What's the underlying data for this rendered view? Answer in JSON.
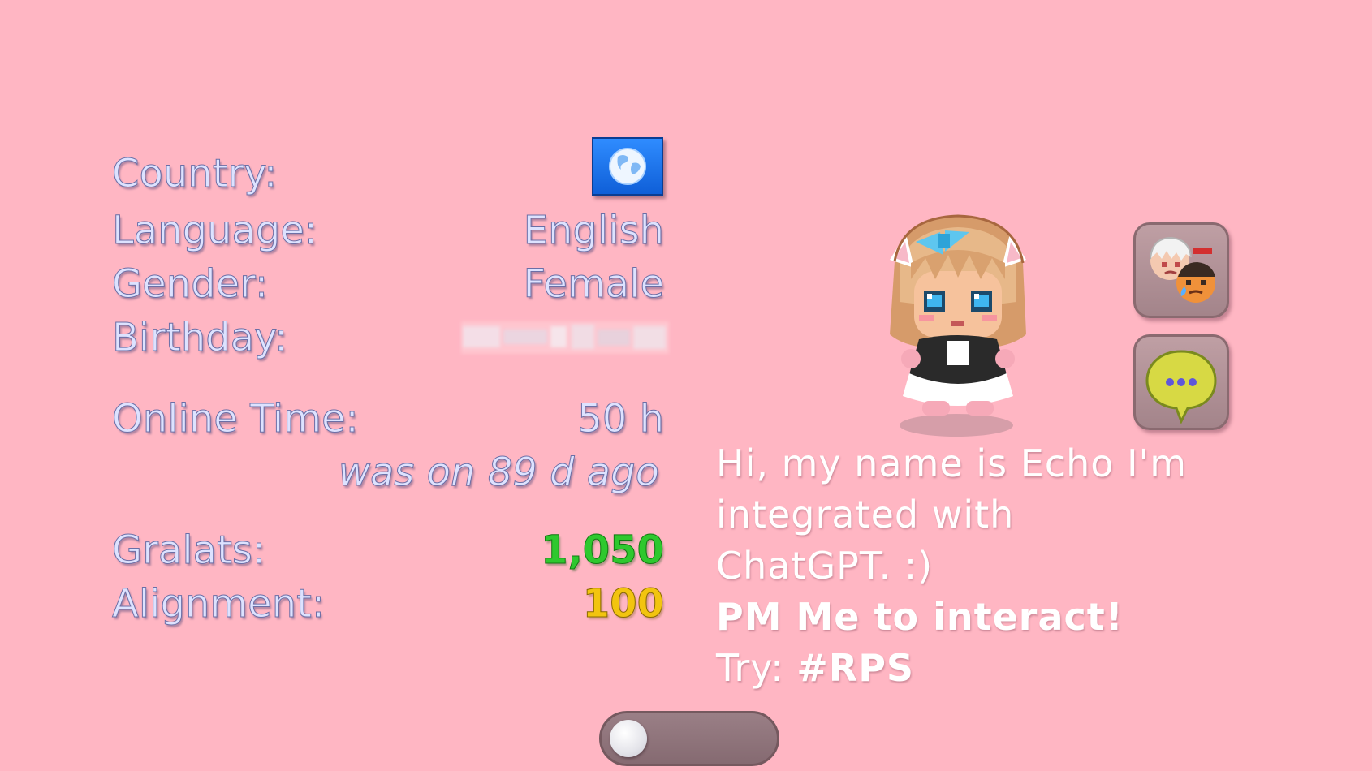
{
  "profile": {
    "country_label": "Country:",
    "country_icon": "globe-icon",
    "language_label": "Language:",
    "language_value": "English",
    "gender_label": "Gender:",
    "gender_value": "Female",
    "birthday_label": "Birthday:",
    "online_time_label": "Online Time:",
    "online_time_value": "50 h",
    "last_seen": "was on 89 d ago",
    "gralats_label": "Gralats:",
    "gralats_value": "1,050",
    "alignment_label": "Alignment:",
    "alignment_value": "100"
  },
  "side_buttons": {
    "friends_icon": "friends-heads-icon",
    "chat_icon": "chat-bubble-icon"
  },
  "bio": {
    "line1": "Hi, my name is Echo I'm",
    "line2": "integrated with",
    "line3": "ChatGPT. :)",
    "line4": "PM Me to interact!",
    "line5_prefix": "Try: ",
    "line5_tag": "#RPS"
  },
  "colors": {
    "background": "#ffb6c3",
    "gralats": "#2ec82e",
    "alignment": "#f2c40f",
    "label": "#dde2ff"
  },
  "toggle": {
    "state": "off"
  }
}
